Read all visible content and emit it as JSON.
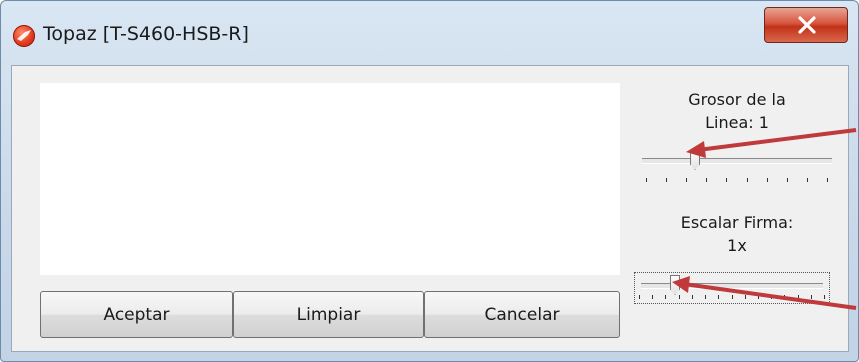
{
  "window": {
    "title": "Topaz [T-S460-HSB-R]"
  },
  "buttons": {
    "accept": "Aceptar",
    "clear": "Limpiar",
    "cancel": "Cancelar"
  },
  "controls": {
    "line_width": {
      "label_line1": "Grosor de la",
      "label_line2": "Linea: 1",
      "value": 1,
      "min": 1,
      "max": 10,
      "ticks": 10
    },
    "scale": {
      "label_line1": "Escalar Firma:",
      "label_line2": "1x",
      "value": 1,
      "min": 1,
      "max": 15,
      "ticks": 15
    }
  },
  "icons": {
    "app": "topaz-app-icon",
    "close": "close-x-icon"
  },
  "colors": {
    "arrow": "#c0393b",
    "close_button": "#c13217"
  }
}
